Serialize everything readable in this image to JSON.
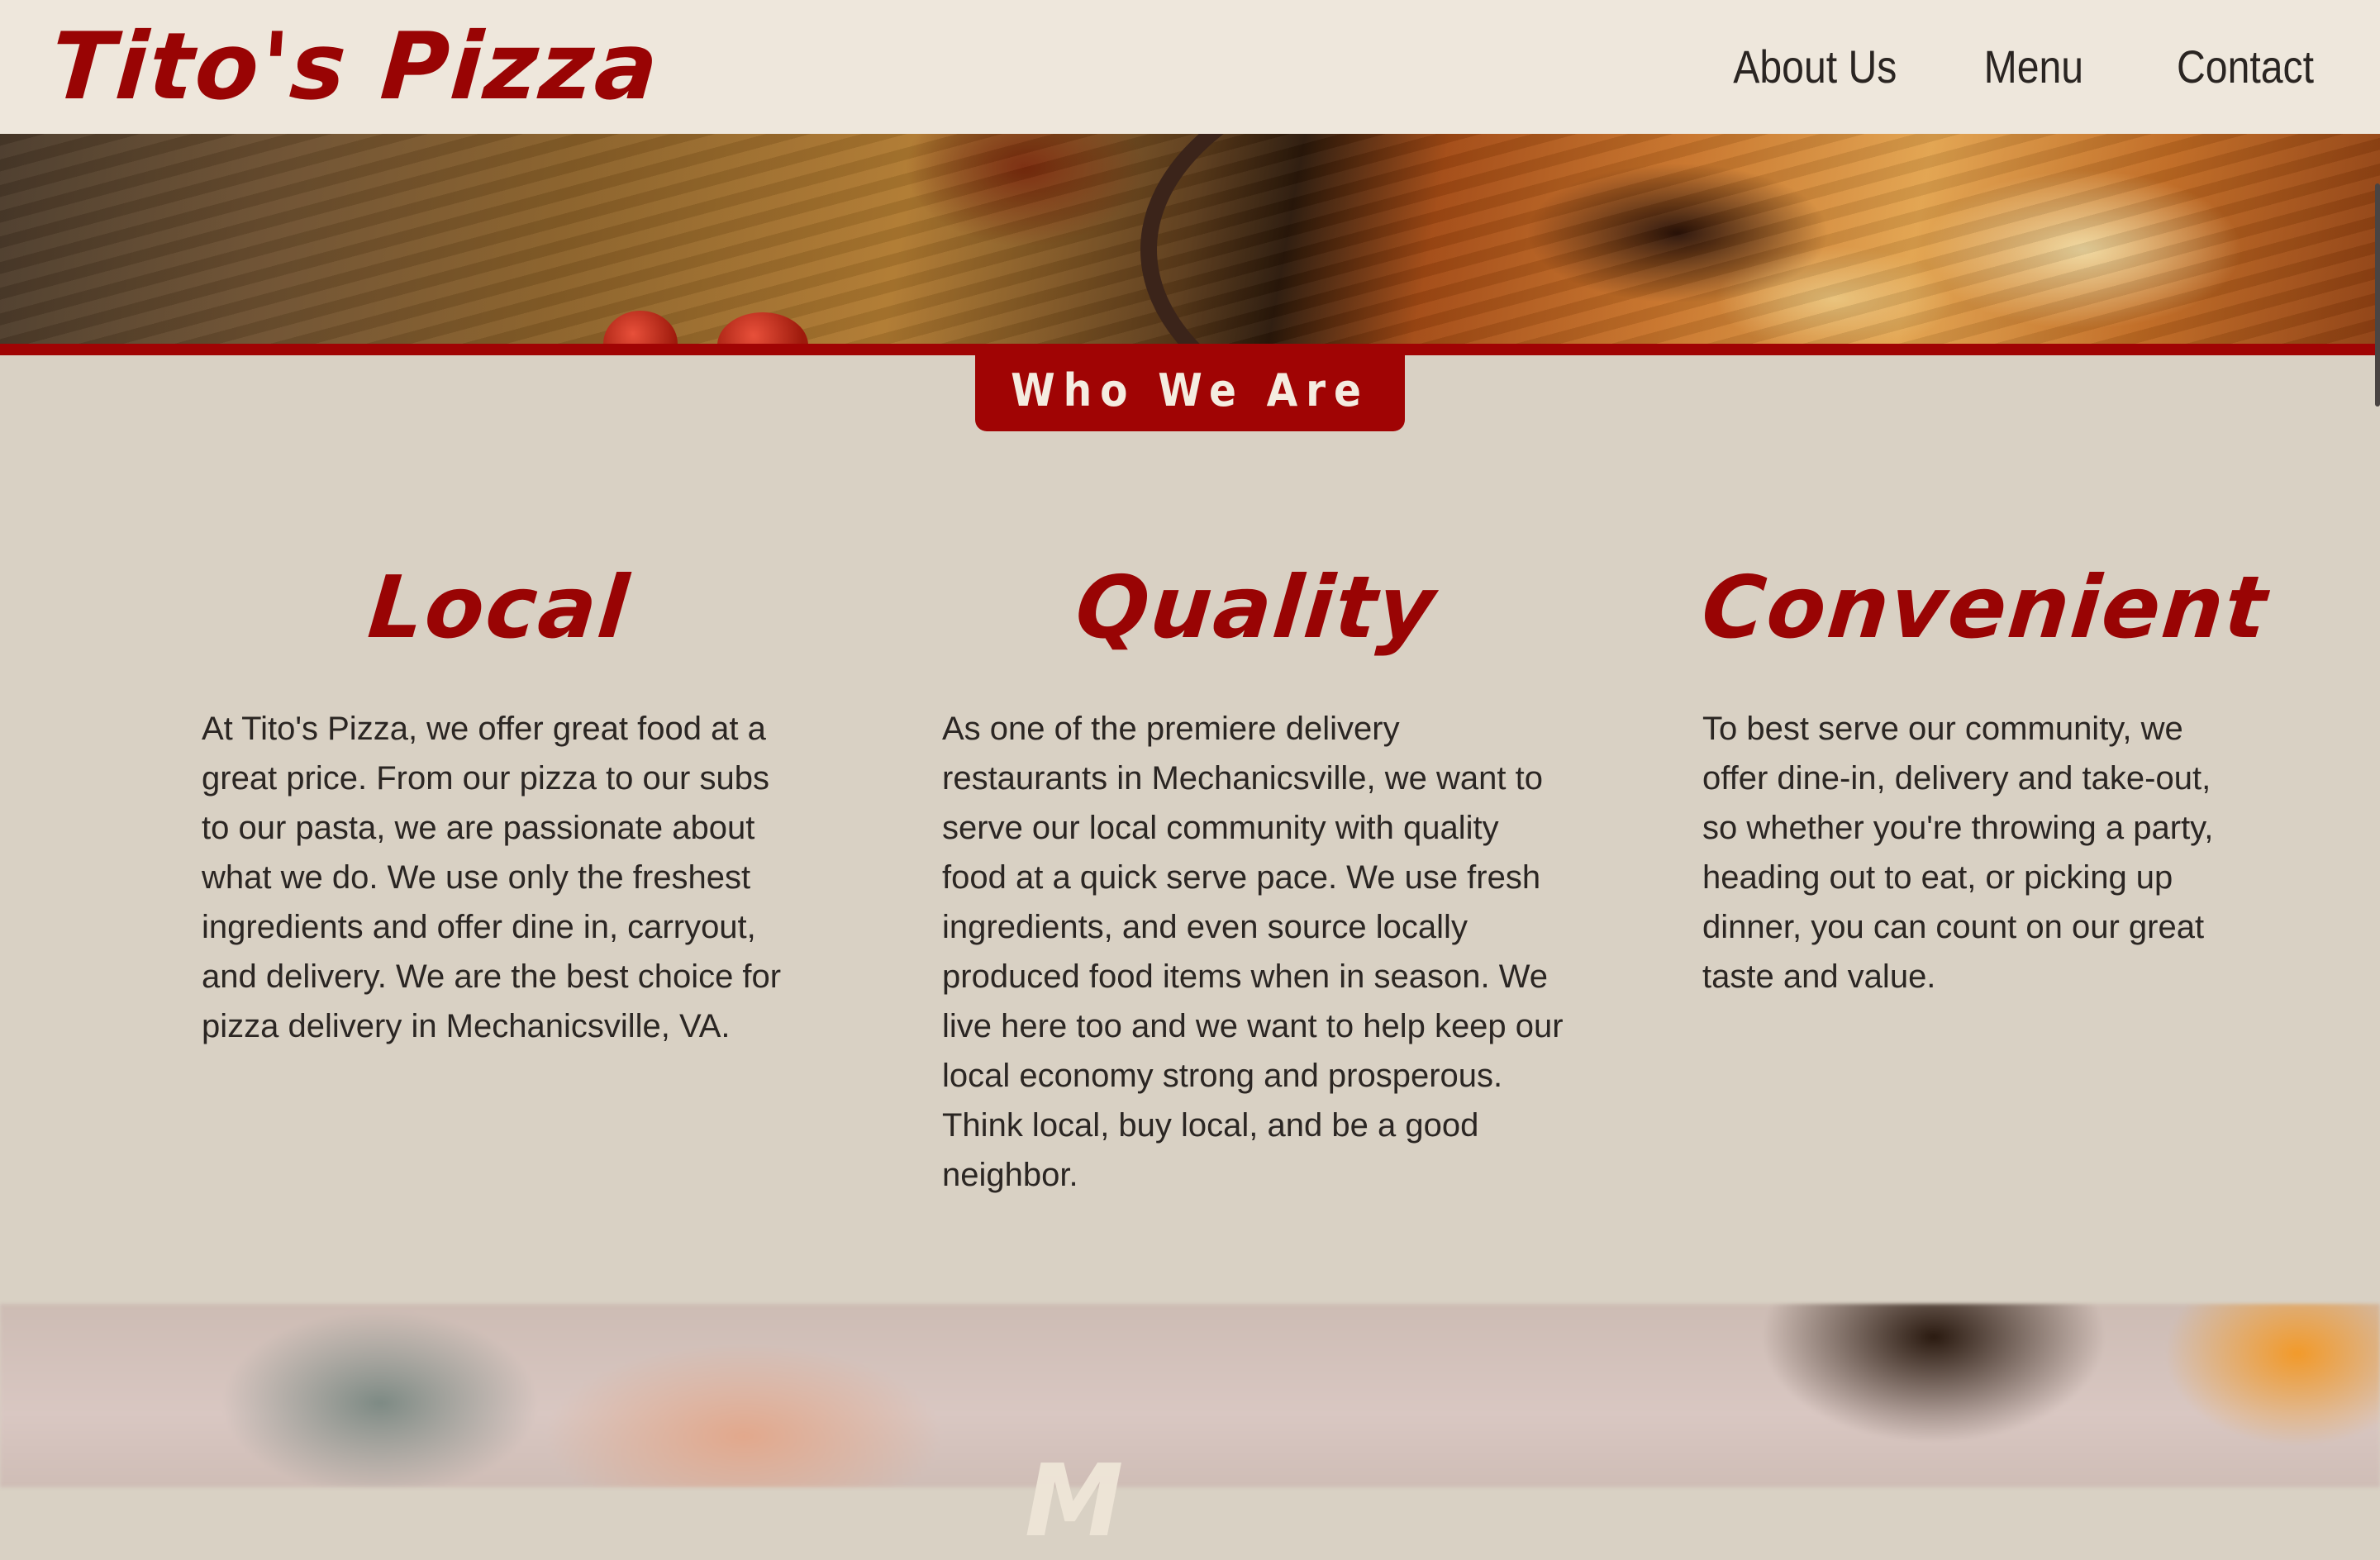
{
  "header": {
    "logo": "Tito's Pizza",
    "nav": [
      {
        "label": "About Us"
      },
      {
        "label": "Menu"
      },
      {
        "label": "Contact"
      }
    ]
  },
  "about": {
    "badge": "Who We Are",
    "columns": [
      {
        "title": "Local",
        "text": "At Tito's Pizza, we offer great food at a great price. From our pizza to our subs to our pasta, we are passionate about what we do. We use only the freshest ingredients and offer dine in, carryout, and delivery. We are the best choice for pizza delivery in Mechanicsville, VA."
      },
      {
        "title": "Quality",
        "text": "As one of the premiere delivery restaurants in Mechanicsville, we want to serve our local community with quality food at a quick serve pace. We use fresh ingredients, and even source locally produced food items when in season. We live here too and we want to help keep our local economy strong and prosperous. Think local, buy local, and be a good neighbor."
      },
      {
        "title": "Convenient",
        "text": "To best serve our community, we offer dine-in, delivery and take-out, so whether you're throwing a party, heading out to eat, or picking up dinner, you can count on our great taste and value."
      }
    ]
  },
  "menu_section": {
    "heading_partial": "M"
  },
  "colors": {
    "brand_red": "#a00404",
    "header_bg": "#eee7dc",
    "page_bg": "#d9d1c4",
    "text": "#2b2623"
  }
}
